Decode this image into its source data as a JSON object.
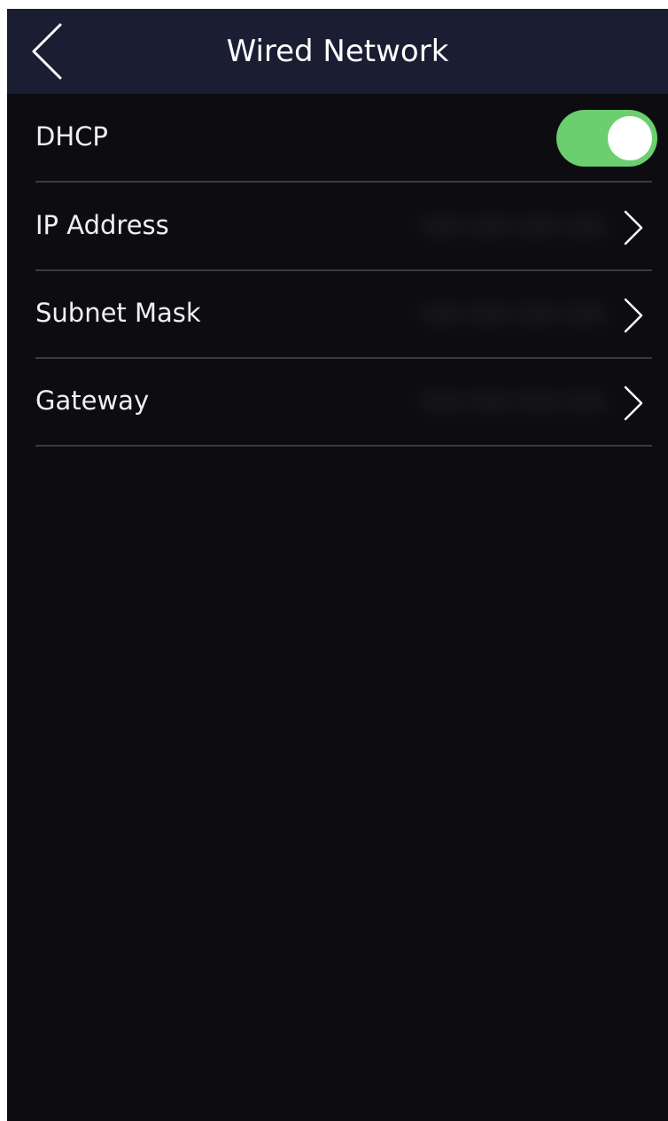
{
  "header": {
    "title": "Wired Network"
  },
  "rows": [
    {
      "label": "DHCP",
      "type": "toggle",
      "on": true
    },
    {
      "label": "IP Address",
      "type": "link",
      "value": "xxx.xxx.xxx.xxx"
    },
    {
      "label": "Subnet Mask",
      "type": "link",
      "value": "xxx.xxx.xxx.xxx"
    },
    {
      "label": "Gateway",
      "type": "link",
      "value": "xxx.xxx.xxx.xxx"
    }
  ],
  "colors": {
    "header_bg": "#1b1e33",
    "screen_bg": "#0d0d11",
    "toggle_on": "#6bcf6f",
    "divider": "#3a3a40"
  },
  "icons": {
    "back": "chevron-left-icon",
    "row_arrow": "chevron-right-icon"
  }
}
